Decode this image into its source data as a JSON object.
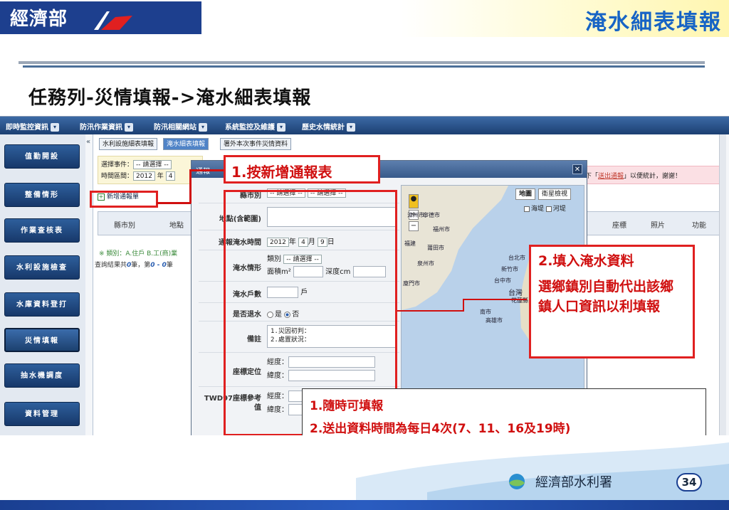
{
  "slide": {
    "logo_text": "經濟部",
    "title_right": "淹水細表填報",
    "heading": "任務列-災情填報->淹水細表填報",
    "page_number": "34",
    "footer_logo": "經濟部水利署"
  },
  "menubar": {
    "items": [
      "即時監控資訊",
      "防汛作業資訊",
      "防汛相關網站",
      "系統監控及維護",
      "歷史水情統計"
    ]
  },
  "sidebar": {
    "items": [
      "值勤開設",
      "整備情形",
      "作業查核表",
      "水利設施檢查",
      "水庫資料登打",
      "災情填報",
      "抽水機調度",
      "資料管理"
    ],
    "active_index": 5
  },
  "tabs": [
    "水利設施細表填報",
    "淹水細表填報",
    "署外本次事件災情資料"
  ],
  "active_tab": 1,
  "filter": {
    "event_label": "選擇事件：",
    "event_value": "-- 請選擇 --",
    "period_label": "時間區間：",
    "year_value": "2012",
    "year_unit": "年",
    "month_value": "4"
  },
  "add_button": "新增通報單",
  "notice": {
    "prefix": "下「",
    "link": "送出通報",
    "suffix": "」以便統計，謝謝！"
  },
  "table_headers": [
    "縣市別",
    "地點",
    "座標",
    "照片",
    "功能"
  ],
  "category_note": "※ 類別：A.住戶  B.工(商)業",
  "results": {
    "prefix": "查詢結果共",
    "count": "0",
    "mid": "筆，第",
    "range": "0 - 0",
    "suffix": "筆"
  },
  "dialog": {
    "title": "通報",
    "fields": {
      "county_label": "縣市別",
      "county_value1": "-- 請選擇 --",
      "county_value2": "-- 請選擇 --",
      "location_label": "地點(含範圍)",
      "time_label": "通報淹水時間",
      "year": "2012",
      "year_unit": "年",
      "month": "4",
      "month_unit": "月",
      "day": "9",
      "day_unit": "日",
      "flood_label": "淹水情形",
      "type_label": "類別",
      "type_value": "-- 請選擇 --",
      "area_label": "面積m²",
      "depth_label": "深度cm",
      "households_label": "淹水戶數",
      "households_unit": "戶",
      "receded_label": "是否退水",
      "yes": "是",
      "no": "否",
      "remarks_label": "備註",
      "remark_line1": "1.災因初判：",
      "remark_line2": "2.處置狀況：",
      "coord_label": "座標定位",
      "lon_label": "經度：",
      "lat_label": "緯度：",
      "twd_label": "TWD97座標參考值",
      "twd_lon_label": "經度：",
      "twd_lat_label": "緯度："
    },
    "map": {
      "btn_map": "地圖",
      "btn_satellite": "衛星檢視",
      "cb_seawall": "海堤",
      "cb_river": "河堤",
      "labels": [
        "漳州市",
        "廈門市",
        "福州市",
        "寧德市",
        "福建",
        "莆田市",
        "泉州市",
        "台北市",
        "新竹市",
        "台中市",
        "台灣",
        "花蓮縣",
        "高雄市",
        "南市"
      ]
    }
  },
  "annotations": {
    "step1": "1.按新增通報表",
    "step2_title": "2.填入淹水資料",
    "step2_body": "選鄉鎮別自動代出該鄉鎮人口資訊以利填報",
    "note_line1": "1.隨時可填報",
    "note_line2": "2.送出資料時間為每日4次(7、11、16及19時)"
  },
  "colors": {
    "accent_blue": "#1764c5",
    "annotation_red": "#e02020",
    "menubar": "#1c3f72"
  }
}
